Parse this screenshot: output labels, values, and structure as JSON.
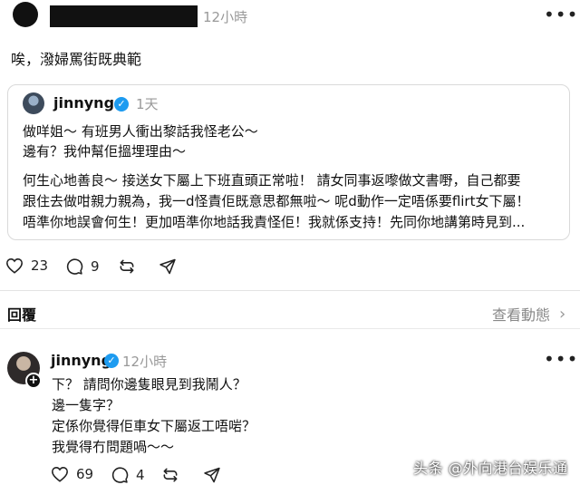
{
  "top_post": {
    "time": "12小時",
    "text": "唉，潑婦罵街既典範"
  },
  "quote": {
    "username": "jinnyng",
    "time": "1天",
    "lines": [
      "做咩姐～ 有班男人衝出黎話我怪老公～",
      "邊有？我仲幫佢搵埋理由～",
      "何生心地善良～ 接送女下屬上下班直頭正常啦！ 請女同事返嚟做文書嘢，自己都要",
      "跟住去做咁親力親為，我一d怪責佢既意思都無啦～ 呢d動作一定唔係要flirt女下屬！",
      "唔準你地誤會何生！更加唔準你地話我責怪佢！我就係支持！先同你地講第時見到..."
    ]
  },
  "top_actions": {
    "likes": "23",
    "comments": "9"
  },
  "reply_header": {
    "label": "回覆",
    "view_activity": "查看動態",
    "chevron": "›"
  },
  "reply": {
    "username": "jinnyng",
    "time": "12小時",
    "lines": [
      "下？ 請問你邊隻眼見到我鬧人？",
      "邊一隻字？",
      "定係你覺得佢車女下屬返工唔啱？",
      "我覺得冇問題喎～～"
    ],
    "likes": "69",
    "comments": "4"
  },
  "watermark": "头条 @外向港台娱乐通",
  "icons": {
    "verified": "verified-badge-icon",
    "like": "heart-icon",
    "comment": "comment-icon",
    "repost": "repost-icon",
    "share": "share-icon",
    "more": "more-icon"
  },
  "colors": {
    "verified": "#1d9bf0",
    "muted": "#999999"
  }
}
